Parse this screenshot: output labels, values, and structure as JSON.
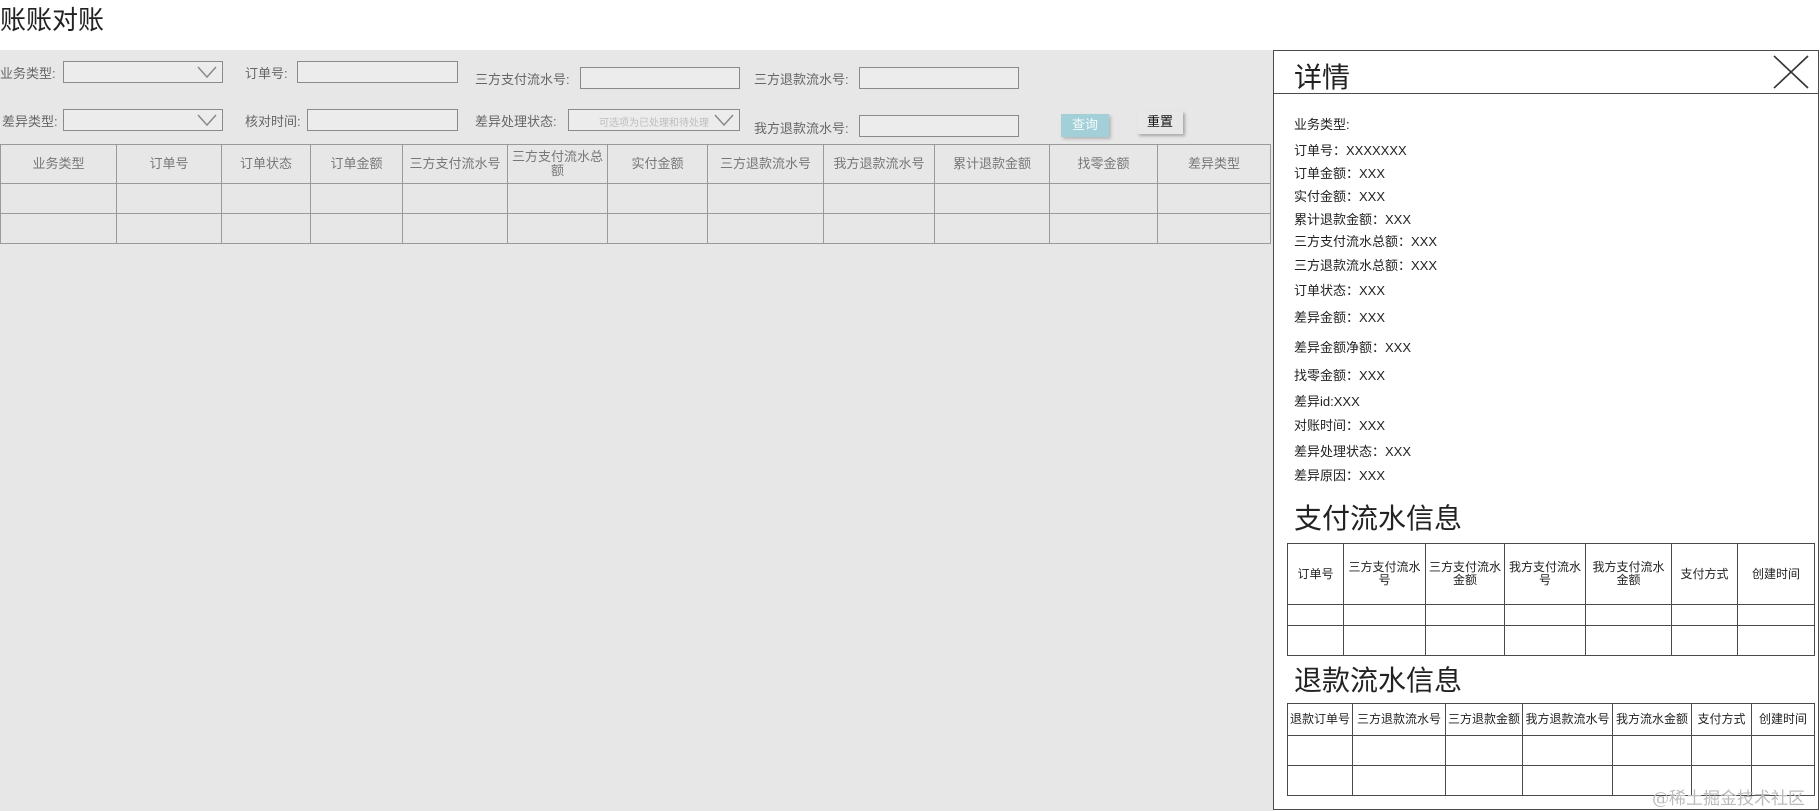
{
  "page": {
    "title": "账账对账"
  },
  "filters": {
    "business_type_label": "业务类型:",
    "order_no_label": "订单号:",
    "third_pay_no_label": "三方支付流水号:",
    "third_refund_no_label": "三方退款流水号:",
    "diff_type_label": "差异类型:",
    "check_time_label": "核对时间:",
    "diff_status_label": "差异处理状态:",
    "diff_status_placeholder": "可选项为已处理和待处理",
    "our_refund_no_label": "我方退款流水号:",
    "query_label": "查询",
    "reset_label": "重置"
  },
  "main_table": {
    "headers": [
      "业务类型",
      "订单号",
      "订单状态",
      "订单金额",
      "三方支付流水号",
      "三方支付流水总额",
      "实付金额",
      "三方退款流水号",
      "我方退款流水号",
      "累计退款金额",
      "找零金额",
      "差异类型"
    ]
  },
  "detail": {
    "title": "详情",
    "fields": [
      "业务类型:",
      "订单号：XXXXXXX",
      "订单金额：XXX",
      "实付金额：XXX",
      "累计退款金额：XXX",
      "三方支付流水总额：XXX",
      "三方退款流水总额：XXX",
      "订单状态：XXX",
      "差异金额：XXX",
      "差异金额净额：XXX",
      "找零金额：XXX",
      "差异id:XXX",
      "对账时间：XXX",
      "差异处理状态：XXX",
      "差异原因：XXX"
    ],
    "pay_section": {
      "title": "支付流水信息",
      "headers": [
        "订单号",
        "三方支付流水号",
        "三方支付流水金额",
        "我方支付流水号",
        "我方支付流水金额",
        "支付方式",
        "创建时间"
      ]
    },
    "refund_section": {
      "title": "退款流水信息",
      "headers": [
        "退款订单号",
        "三方退款流水号",
        "三方退款金额",
        "我方退款流水号",
        "我方流水金额",
        "支付方式",
        "创建时间"
      ]
    }
  },
  "watermark": "@稀土掘金技术社区"
}
